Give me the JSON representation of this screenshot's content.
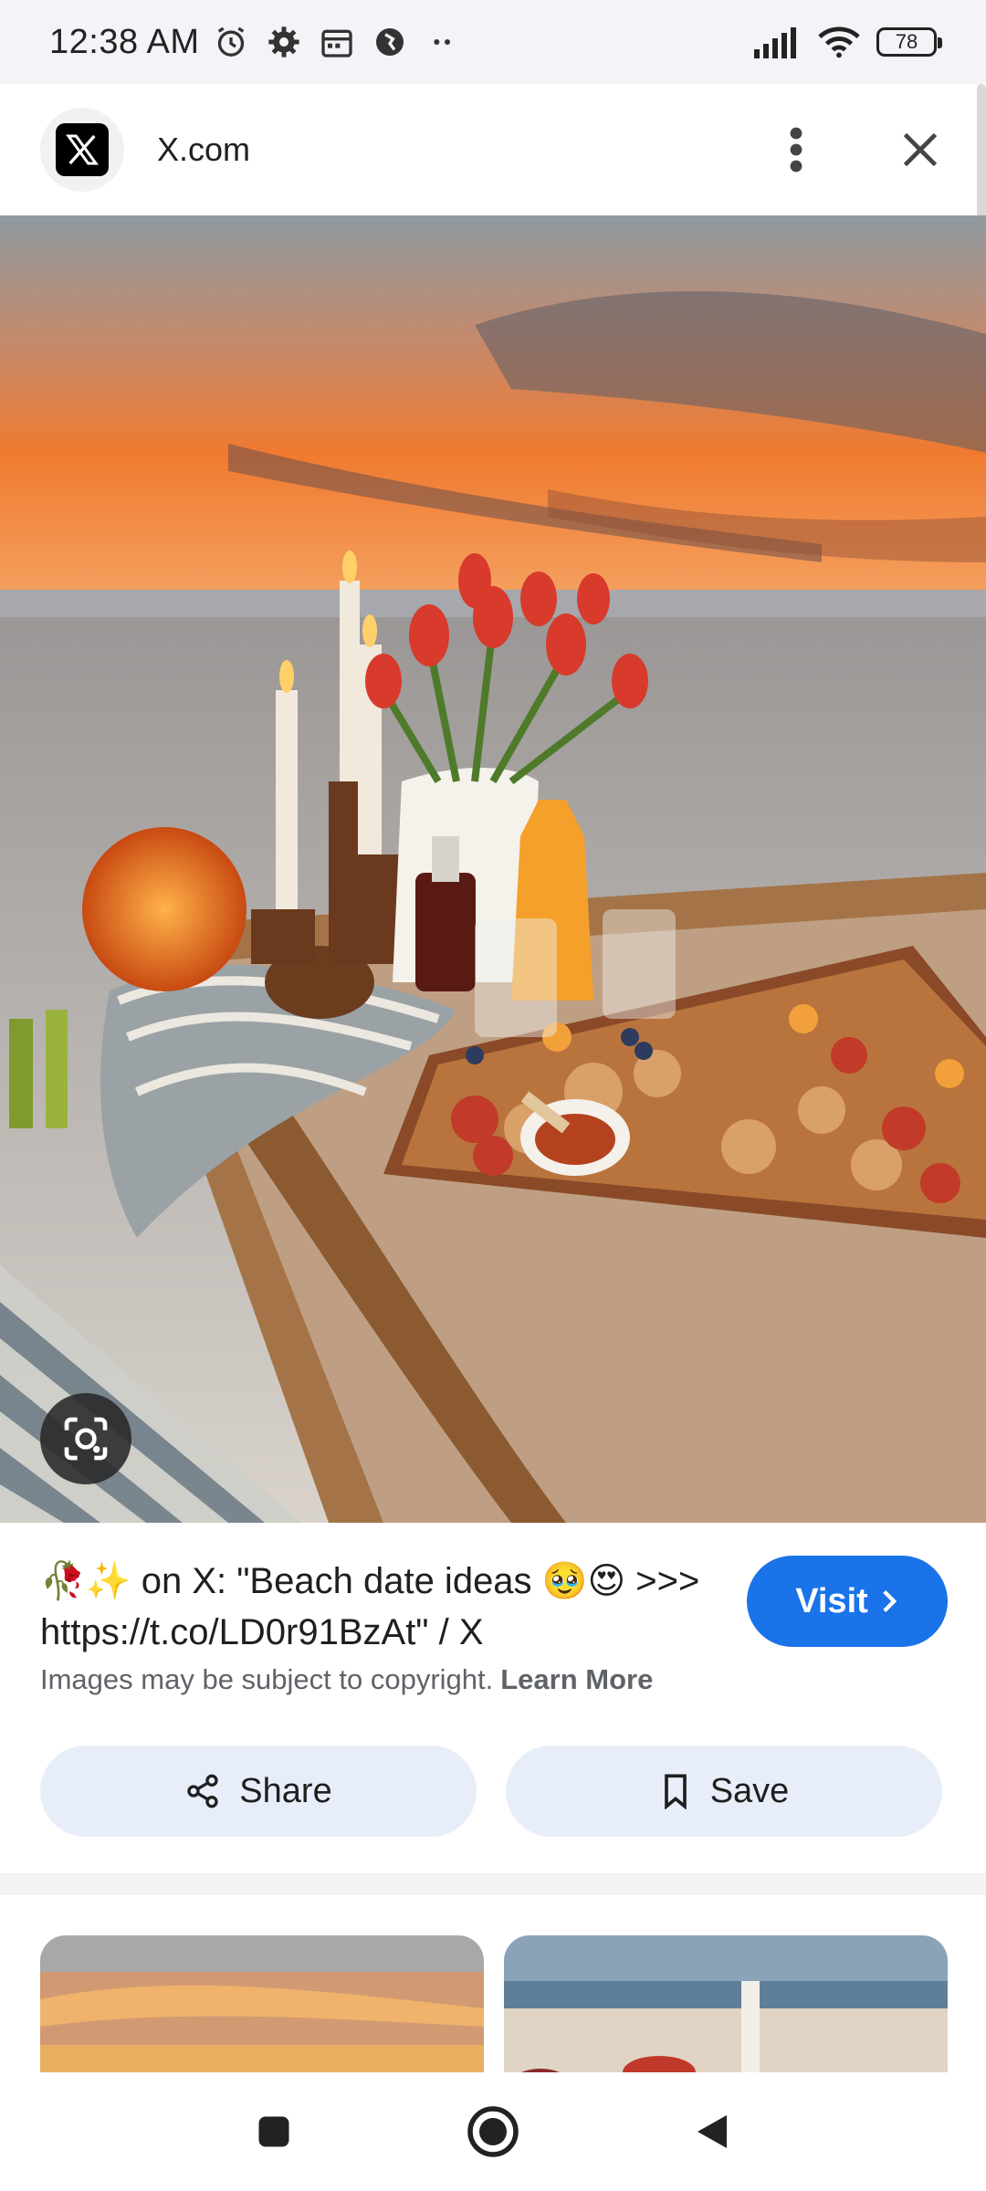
{
  "status_bar": {
    "time": "12:38 AM",
    "battery": "78",
    "icons_left": [
      "alarm-icon",
      "gear-icon",
      "calendar-icon",
      "vpn-icon",
      "more-dots-icon"
    ],
    "icons_right": [
      "signal-icon",
      "wifi-icon",
      "battery-icon"
    ]
  },
  "header": {
    "title": "X.com",
    "logo": "x-logo-icon",
    "menu_icon": "more-vert-icon",
    "close_icon": "close-icon"
  },
  "result": {
    "caption_emoji": "🥀✨",
    "caption_text": " on X: \"Beach date ideas 🥹😍 >>> https://t.co/LD0r91BzAt\" / X",
    "visit_label": "Visit",
    "copyright_text": "Images may be subject to copyright.",
    "learn_more": "Learn More",
    "share_label": "Share",
    "save_label": "Save"
  },
  "navigation": {
    "buttons": [
      "recents-icon",
      "home-icon",
      "back-icon"
    ]
  },
  "colors": {
    "accent": "#1a73e8",
    "action_bg": "#e8eef9",
    "status_bg": "#f3f3f8"
  }
}
